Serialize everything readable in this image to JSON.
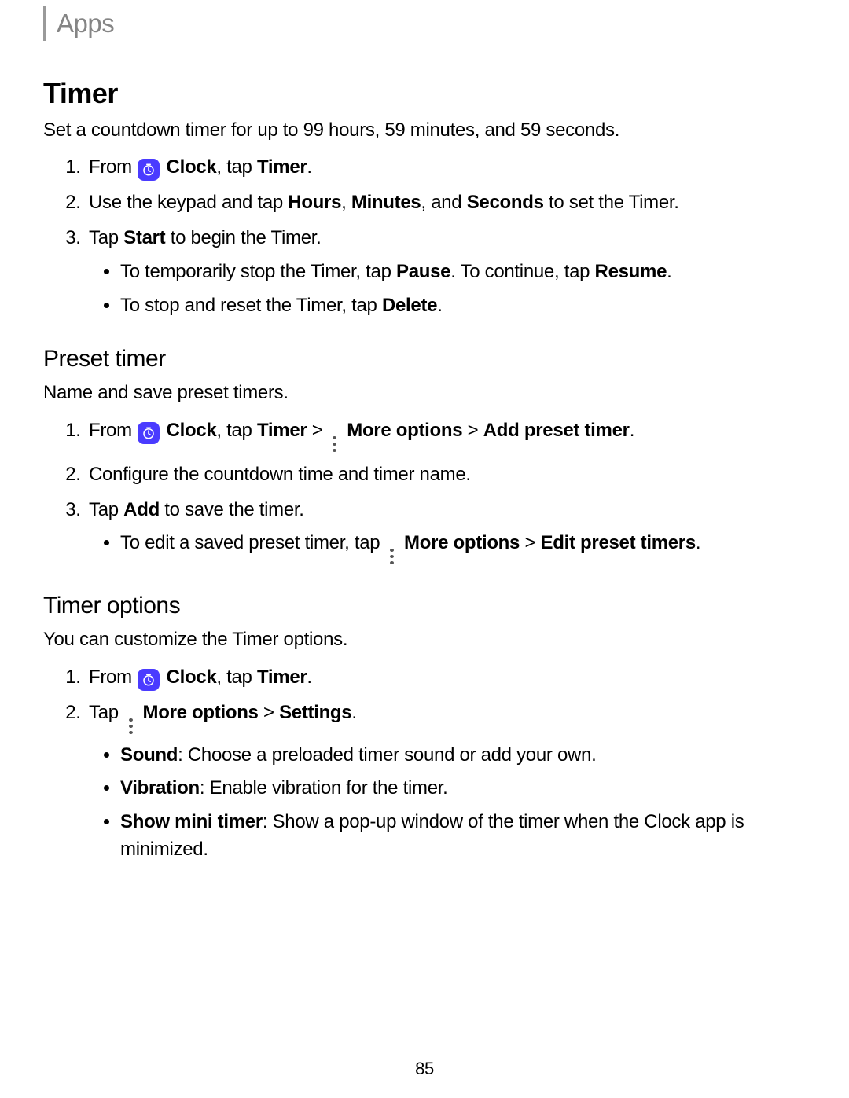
{
  "breadcrumb": "Apps",
  "page_number": "85",
  "timer": {
    "heading": "Timer",
    "intro": "Set a countdown timer for up to 99 hours, 59 minutes, and 59 seconds.",
    "step1_pre": "From ",
    "step1_clock": "Clock",
    "step1_mid": ", tap ",
    "step1_timer": "Timer",
    "step1_post": ".",
    "step2_pre": "Use the keypad and tap ",
    "step2_hours": "Hours",
    "step2_sep1": ", ",
    "step2_minutes": "Minutes",
    "step2_sep2": ", and ",
    "step2_seconds": "Seconds",
    "step2_post": " to set the Timer.",
    "step3_pre": "Tap ",
    "step3_start": "Start",
    "step3_post": " to begin the Timer.",
    "sub1_pre": "To temporarily stop the Timer, tap ",
    "sub1_pause": "Pause",
    "sub1_mid": ". To continue, tap ",
    "sub1_resume": "Resume",
    "sub1_post": ".",
    "sub2_pre": "To stop and reset the Timer, tap ",
    "sub2_delete": "Delete",
    "sub2_post": "."
  },
  "preset": {
    "heading": "Preset timer",
    "intro": "Name and save preset timers.",
    "step1_pre": "From ",
    "step1_clock": "Clock",
    "step1_mid": ", tap ",
    "step1_timer": "Timer",
    "step1_gt1": " > ",
    "step1_more": "More options",
    "step1_gt2": " > ",
    "step1_add": "Add preset timer",
    "step1_post": ".",
    "step2": "Configure the countdown time and timer name.",
    "step3_pre": "Tap ",
    "step3_add": "Add",
    "step3_post": " to save the timer.",
    "sub1_pre": "To edit a saved preset timer, tap ",
    "sub1_more": "More options",
    "sub1_gt": " > ",
    "sub1_edit": "Edit preset timers",
    "sub1_post": "."
  },
  "options": {
    "heading": "Timer options",
    "intro": "You can customize the Timer options.",
    "step1_pre": "From ",
    "step1_clock": "Clock",
    "step1_mid": ", tap ",
    "step1_timer": "Timer",
    "step1_post": ".",
    "step2_pre": "Tap ",
    "step2_more": "More options",
    "step2_gt": " > ",
    "step2_settings": "Settings",
    "step2_post": ".",
    "sub1_b": "Sound",
    "sub1_rest": ": Choose a preloaded timer sound or add your own.",
    "sub2_b": "Vibration",
    "sub2_rest": ": Enable vibration for the timer.",
    "sub3_b": "Show mini timer",
    "sub3_rest": ": Show a pop-up window of the timer when the Clock app is minimized."
  }
}
